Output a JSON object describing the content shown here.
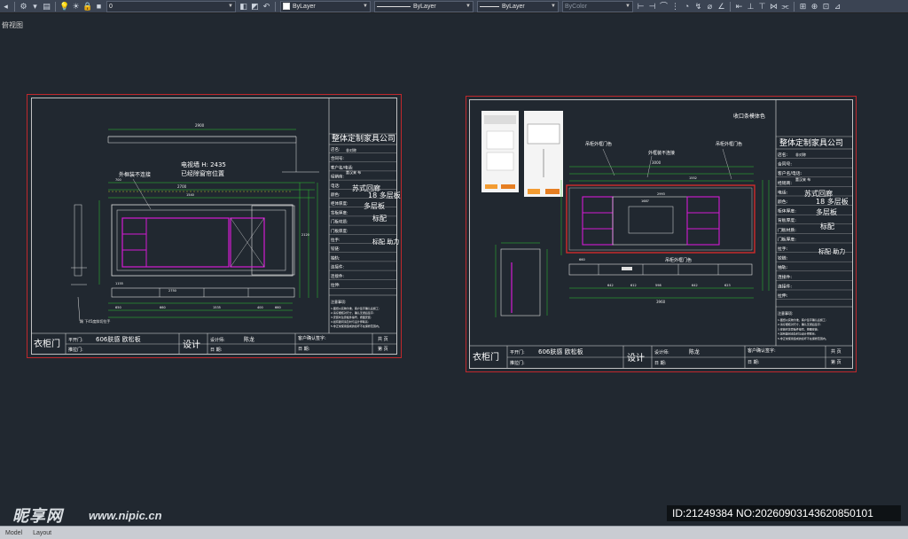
{
  "toolbar": {
    "layer_value": "0",
    "color_value": "ByLayer",
    "linetype_value": "ByLayer",
    "lineweight_value": "ByLayer",
    "plotstyle_value": "ByColor"
  },
  "view_label": "俯视图",
  "left_sheet": {
    "company": "整体定制家具公司",
    "fields": [
      "店名:",
      "合同号:",
      "客户名/电话:",
      "经销商:",
      "电话:",
      "颜色:",
      "柜体厚度:",
      "背板厚度:",
      "门板材质:",
      "门板厚度:",
      "拉手:",
      "铰链:",
      "抽轨:",
      "连接件:",
      "连接件:",
      "拉伸:"
    ],
    "values": {
      "store": "非对称",
      "dealer": "董汉来 布",
      "color": "苏式回廊",
      "thickness": "18 多层板",
      "back": "多层板",
      "door": "标配",
      "rail": "标配 助力"
    },
    "notes_title": "注意事项:",
    "notes": [
      "1.图纸以实物为准，客户签字确认后施工;",
      "2.请仔细核对尺寸，确认无误后签字;",
      "3.安装时注意板件编号，按图安装;",
      "4.如有疑问请及时与设计师联系;",
      "5.非正常使用造成的损坏不在保修范围内。"
    ],
    "door_type_label": "平开门:",
    "door_type_value": "606肤感 欧松板",
    "push_door_label": "推拉门:",
    "cabinet": "衣柜门",
    "design": "设计",
    "designer_label": "设计师:",
    "designer": "陈龙",
    "sign_label": "客户确认签字:",
    "date_label": "日 期:",
    "page": "共 页",
    "sheet_no": "第 页",
    "tv_wall": "电视墙 H: 2435",
    "tv_note": "已经除窗帘位置",
    "outer_note": "外框装不连接",
    "top_dim": "2900",
    "mid_dim": "2700",
    "base_note": "踢 下45度斜切拉手",
    "dims": [
      "700",
      "1540",
      "2750",
      "1155",
      "650",
      "660",
      "1535",
      "400",
      "2120",
      "660"
    ]
  },
  "right_sheet": {
    "top_note": "收口条模体色",
    "note_a": "吊柜外框门色",
    "note_b": "外框装不连接",
    "note_c": "吊柜外框门色",
    "note_d": "吊柜外框门色",
    "overall": "3960",
    "dims": [
      "3000",
      "1552",
      "2993",
      "1687",
      "660",
      "642",
      "612",
      "598",
      "642",
      "623"
    ]
  }
}
